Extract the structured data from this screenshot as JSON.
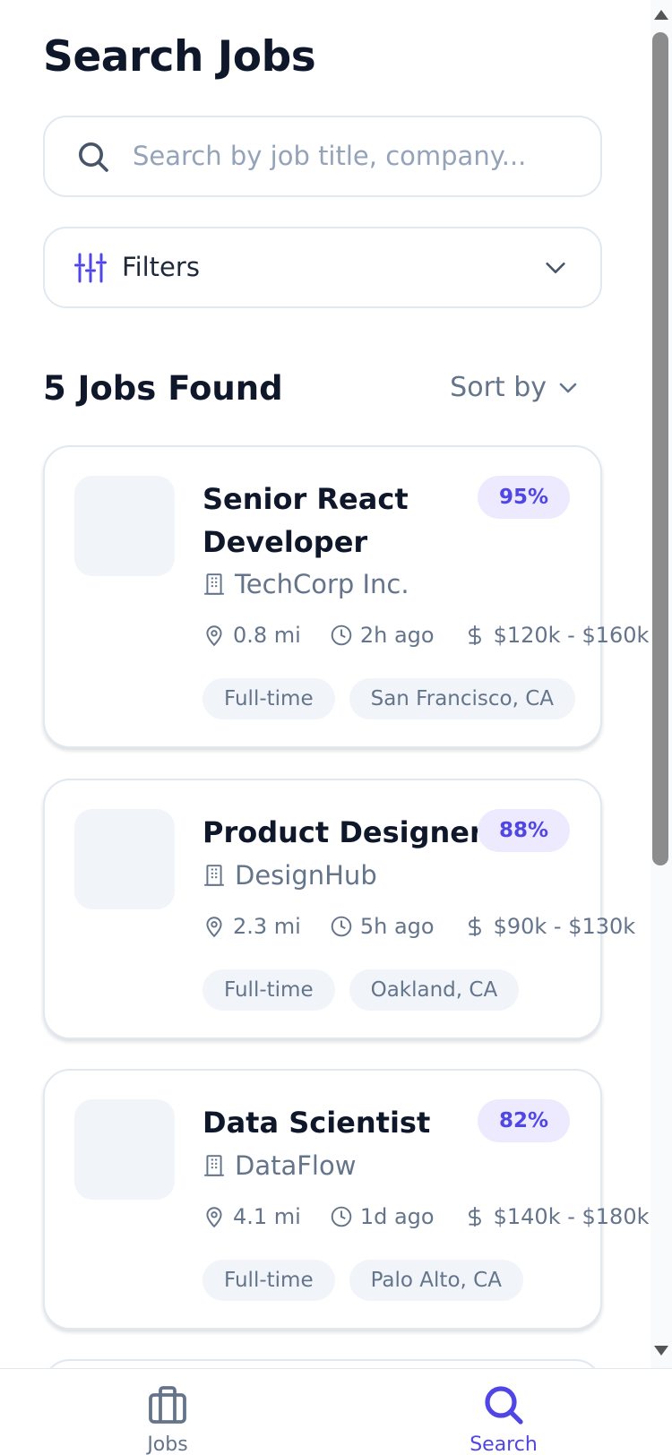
{
  "header": {
    "title": "Search Jobs"
  },
  "search": {
    "placeholder": "Search by job title, company..."
  },
  "filters": {
    "label": "Filters"
  },
  "results": {
    "count_label": "5 Jobs Found",
    "sort_label": "Sort by"
  },
  "jobs": [
    {
      "title": "Senior React Developer",
      "company": "TechCorp Inc.",
      "match": "95%",
      "distance": "0.8 mi",
      "posted": "2h ago",
      "salary": "$120k - $160k",
      "type": "Full-time",
      "location": "San Francisco, CA"
    },
    {
      "title": "Product Designer",
      "company": "DesignHub",
      "match": "88%",
      "distance": "2.3 mi",
      "posted": "5h ago",
      "salary": "$90k - $130k",
      "type": "Full-time",
      "location": "Oakland, CA"
    },
    {
      "title": "Data Scientist",
      "company": "DataFlow",
      "match": "82%",
      "distance": "4.1 mi",
      "posted": "1d ago",
      "salary": "$140k - $180k",
      "type": "Full-time",
      "location": "Palo Alto, CA"
    }
  ],
  "nav": {
    "jobs_label": "Jobs",
    "search_label": "Search",
    "active": "search"
  },
  "colors": {
    "accent": "#4f46e5",
    "match_bg": "#ede9fe",
    "text_primary": "#0f172a",
    "text_muted": "#64748b",
    "tag_bg": "#f1f5f9",
    "border": "#e2e8f0"
  },
  "icons": {
    "search": "search-icon",
    "filters": "sliders-icon",
    "chevron": "chevron-down-icon",
    "company": "building-icon",
    "distance": "map-pin-icon",
    "posted": "clock-icon",
    "salary": "dollar-icon",
    "nav_jobs": "briefcase-icon",
    "nav_search": "search-icon"
  }
}
